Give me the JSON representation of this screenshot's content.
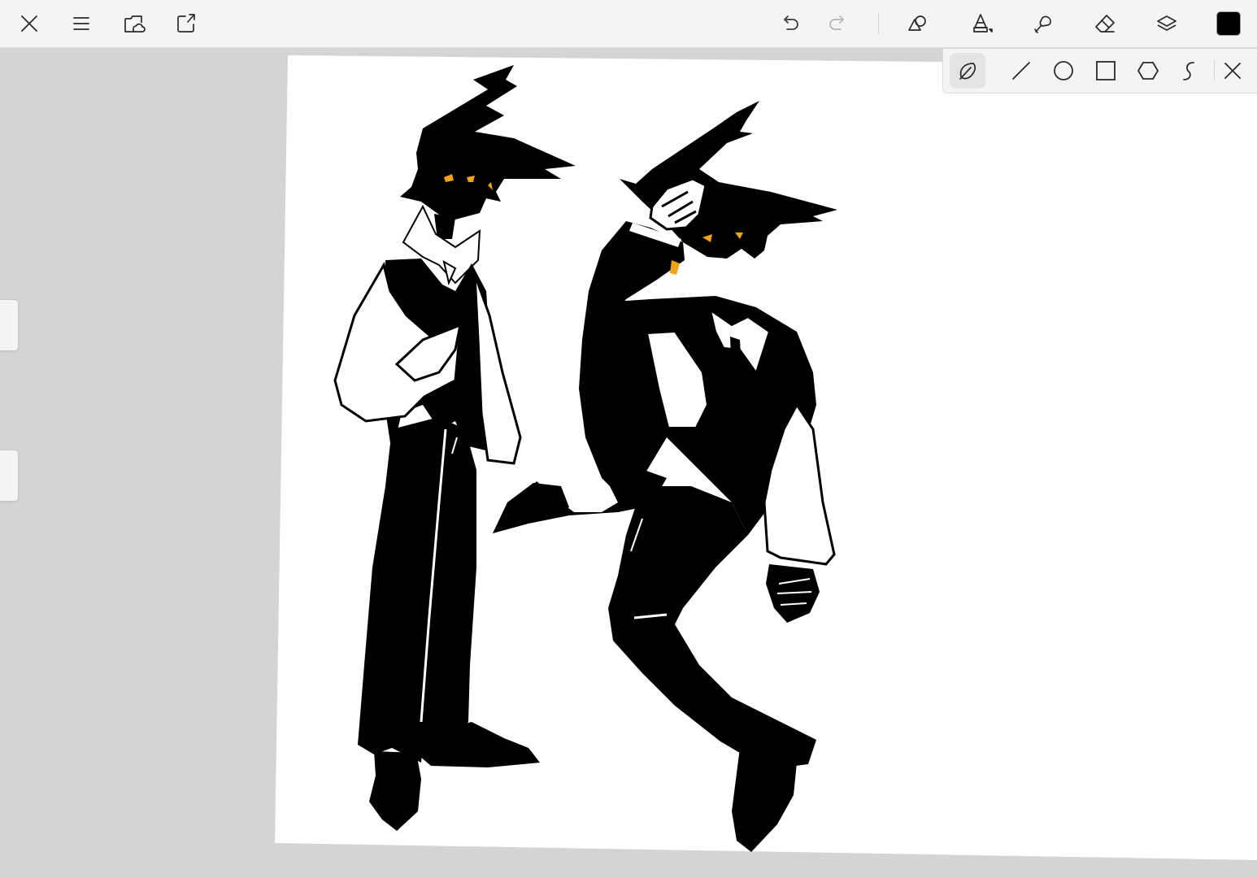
{
  "toolbar": {
    "left_icons": [
      "close-icon",
      "menu-icon",
      "gallery-cloud-icon",
      "import-share-icon"
    ],
    "right_icons": [
      "undo-icon",
      "redo-icon",
      "shapes-icon",
      "brush-icon",
      "smudge-icon",
      "eraser-icon",
      "layers-icon"
    ],
    "current_color": "#000000"
  },
  "shape_bar": {
    "tools": [
      "freehand-icon",
      "line-icon",
      "circle-icon",
      "rectangle-icon",
      "polygon-icon",
      "curve-icon",
      "close-icon"
    ],
    "active_tool": "freehand-icon"
  },
  "canvas": {
    "background": "#ffffff",
    "ink_color": "#000000",
    "accent_color": "#f0a21a",
    "workspace_color": "#d4d4d6"
  }
}
